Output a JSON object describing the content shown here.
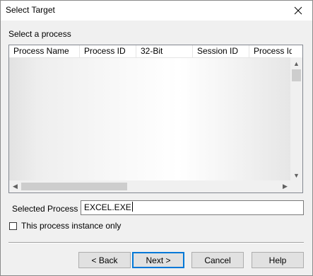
{
  "window": {
    "title": "Select Target"
  },
  "section_label": "Select a process",
  "process_list": {
    "columns": [
      "Process Name",
      "Process ID",
      "32-Bit",
      "Session ID",
      "Process Ide"
    ]
  },
  "selected_process": {
    "label": "Selected Process",
    "value": "EXCEL.EXE"
  },
  "instance_only": {
    "label": "This process instance only",
    "checked": false
  },
  "buttons": {
    "back": "< Back",
    "next": "Next >",
    "cancel": "Cancel",
    "help": "Help"
  }
}
